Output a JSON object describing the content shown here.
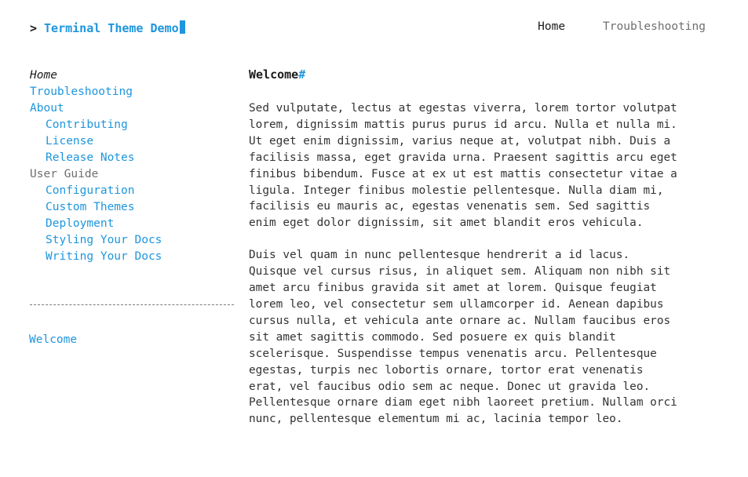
{
  "header": {
    "prompt": ">",
    "brand_title": "Terminal Theme Demo",
    "cursor": "█",
    "nav": [
      {
        "label": "Home",
        "active": true
      },
      {
        "label": "Troubleshooting",
        "active": false
      }
    ]
  },
  "sidebar": {
    "nav_items": [
      {
        "label": "Home",
        "kind": "current",
        "level": 1
      },
      {
        "label": "Troubleshooting",
        "kind": "link",
        "level": 1
      },
      {
        "label": "About",
        "kind": "link",
        "level": 1
      },
      {
        "label": "Contributing",
        "kind": "link",
        "level": 2
      },
      {
        "label": "License",
        "kind": "link",
        "level": 2
      },
      {
        "label": "Release Notes",
        "kind": "link",
        "level": 2
      },
      {
        "label": "User Guide",
        "kind": "section",
        "level": 1
      },
      {
        "label": "Configuration",
        "kind": "link",
        "level": 2
      },
      {
        "label": "Custom Themes",
        "kind": "link",
        "level": 2
      },
      {
        "label": "Deployment",
        "kind": "link",
        "level": 2
      },
      {
        "label": "Styling Your Docs",
        "kind": "link",
        "level": 2
      },
      {
        "label": "Writing Your Docs",
        "kind": "link",
        "level": 2
      }
    ],
    "toc_items": [
      {
        "label": "Welcome"
      }
    ]
  },
  "main": {
    "heading": "Welcome",
    "heading_anchor": "#",
    "paragraphs": [
      "Sed vulputate, lectus at egestas viverra, lorem tortor volutpat lorem, dignissim mattis purus purus id arcu. Nulla et nulla mi. Ut eget enim dignissim, varius neque at, volutpat nibh. Duis a facilisis massa, eget gravida urna. Praesent sagittis arcu eget finibus bibendum. Fusce at ex ut est mattis consectetur vitae a ligula. Integer finibus molestie pellentesque. Nulla diam mi, facilisis eu mauris ac, egestas venenatis sem. Sed sagittis enim eget dolor dignissim, sit amet blandit eros vehicula.",
      "Duis vel quam in nunc pellentesque hendrerit a id lacus. Quisque vel cursus risus, in aliquet sem. Aliquam non nibh sit amet arcu finibus gravida sit amet at lorem. Quisque feugiat lorem leo, vel consectetur sem ullamcorper id. Aenean dapibus cursus nulla, et vehicula ante ornare ac. Nullam faucibus eros sit amet sagittis commodo. Sed posuere ex quis blandit scelerisque. Suspendisse tempus venenatis arcu. Pellentesque egestas, turpis nec lobortis ornare, tortor erat venenatis erat, vel faucibus odio sem ac neque. Donec ut gravida leo. Pellentesque ornare diam eget nibh laoreet pretium. Nullam orci nunc, pellentesque elementum mi ac, lacinia tempor leo."
    ]
  },
  "colors": {
    "accent_blue": "#1e96dd",
    "text_dark": "#1b1b1b",
    "text_body": "#333333",
    "text_muted": "#6f6f6f",
    "divider": "#7a7a7a",
    "background": "#ffffff"
  }
}
